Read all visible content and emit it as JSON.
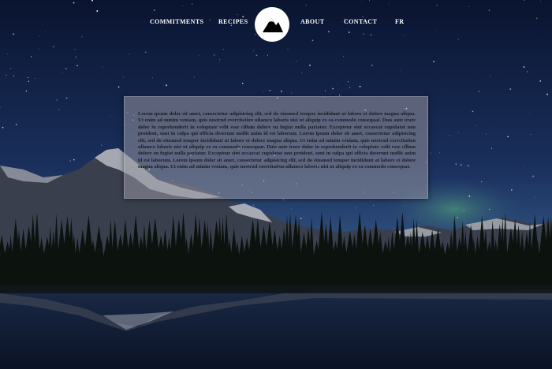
{
  "nav": {
    "items": [
      "COMMITMENTS",
      "RECIPES",
      "ABOUT",
      "CONTACT",
      "FR"
    ],
    "logo_icon": "mountain-icon"
  },
  "content": {
    "text": "Lorem ipsum dolor sit amet, consectetur adipisicing elit, sed do eiusmod tempor incididunt ut labore et dolore magna aliqua. Ut enim ad minim veniam, quis nostrud exercitation ullamco laboris nisi ut aliquip ex ea commodo consequat. Duis aute irure dolor in reprehenderit in voluptate velit esse cillum dolore eu fugiat nulla pariatur. Excepteur sint occaecat cupidatat non proident, sunt in culpa qui officia deserunt mollit anim id est laborum. Lorem ipsum dolor sit amet, consectetur adipisicing elit, sed do eiusmod tempor incididunt ut labore et dolore magna aliqua. Ut enim ad minim veniam, quis nostrud exercitation ullamco laboris nisi ut aliquip ex ea commodo consequat. Duis aute irure dolor in reprehenderit in voluptate velit esse cillum dolore eu fugiat nulla pariatur. Excepteur sint occaecat cupidatat non proident, sunt in culpa qui officia deserunt mollit anim id est laborum. Lorem ipsum dolor sit amet, consectetur adipisicing elit, sed do eiusmod tempor incididunt ut labore et dolore magna aliqua. Ut enim ad minim veniam, quis nostrud exercitation ullamco laboris nisi ut aliquip ex ea commodo consequat."
  },
  "colors": {
    "sky_top": "#0b1630",
    "sky_mid": "#1c3260",
    "nav_text": "#ffffff",
    "panel_text": "#1c1c22"
  }
}
